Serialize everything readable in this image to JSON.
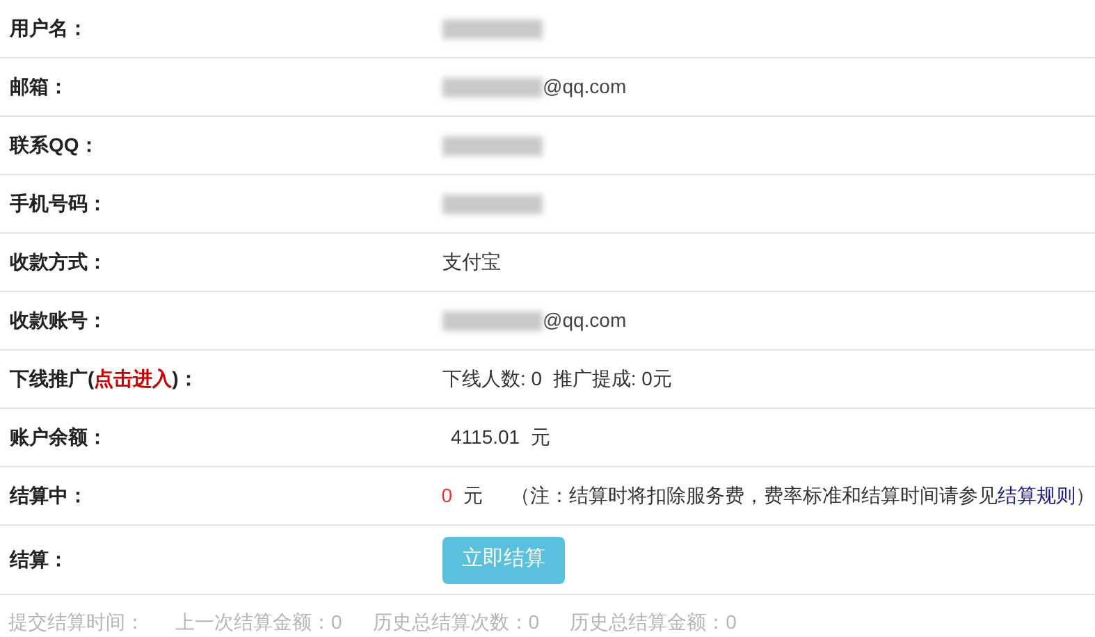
{
  "rows": [
    {
      "label": "用户名：",
      "kind": "redacted"
    },
    {
      "label": "邮箱：",
      "kind": "redacted",
      "suffix": "@qq.com"
    },
    {
      "label": "联系QQ：",
      "kind": "redacted"
    },
    {
      "label": "手机号码：",
      "kind": "redacted"
    },
    {
      "label": "收款方式：",
      "kind": "text",
      "value": "支付宝"
    },
    {
      "label": "收款账号：",
      "kind": "redacted",
      "suffix": "@qq.com"
    },
    {
      "label": "下线推广(",
      "label_link": "点击进入",
      "label_after": ")：",
      "kind": "text",
      "value": "下线人数: 0  推广提成: 0元"
    },
    {
      "label": "账户余额：",
      "kind": "amount",
      "value": "4115.01",
      "unit": "元",
      "alert": false
    },
    {
      "label": "结算中：",
      "kind": "amount",
      "value": "0",
      "unit": "元",
      "alert": true,
      "note": "（注：结算时将扣除服务费，费率标准和结算时间请参见",
      "note_link": "结算规则",
      "note_end": "）"
    },
    {
      "label": "结算：",
      "kind": "button",
      "value": "立即结算"
    }
  ],
  "footer": [
    "提交结算时间：",
    "上一次结算金额：0",
    "历史总结算次数：0",
    "历史总结算金额：0"
  ]
}
